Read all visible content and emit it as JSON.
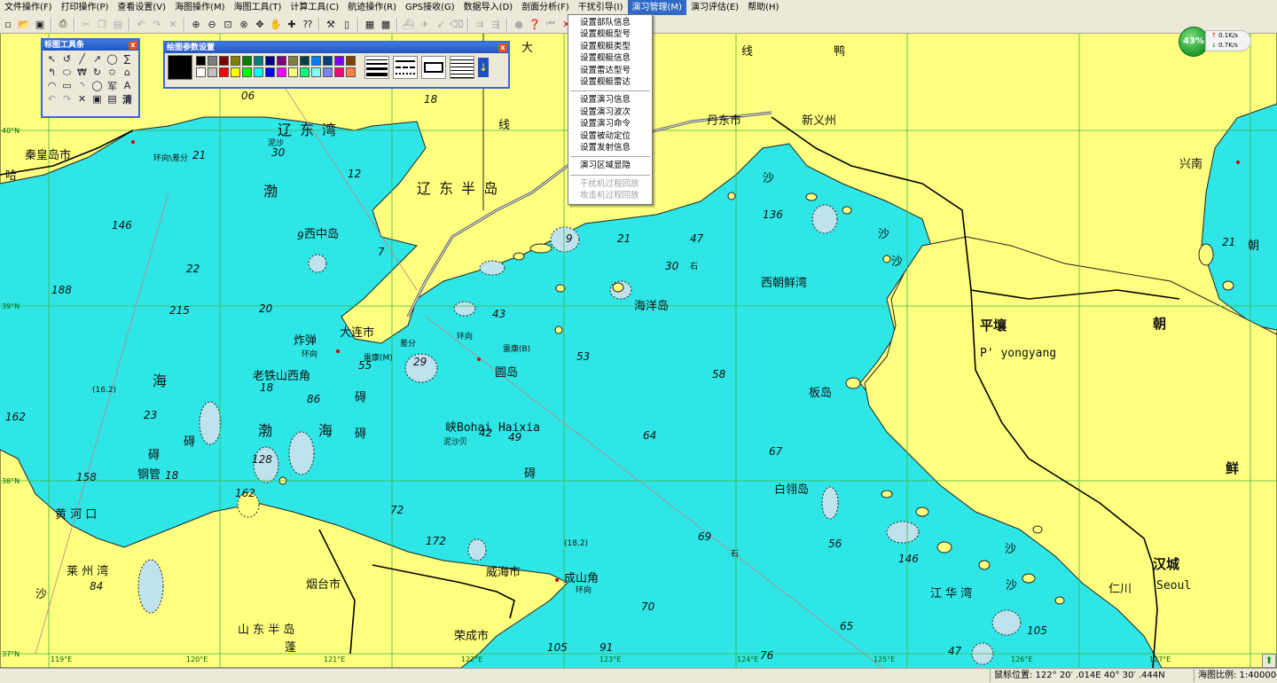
{
  "menubar": [
    "文件操作(F)",
    "打印操作(P)",
    "查看设置(V)",
    "海图操作(M)",
    "海图工具(T)",
    "计算工具(C)",
    "航迹操作(R)",
    "GPS接收(G)",
    "数据导入(D)",
    "剖面分析(F)",
    "干扰引导(I)",
    "演习管理(M)",
    "演习评估(E)",
    "帮助(H)"
  ],
  "dropdown": {
    "group1": [
      "设置部队信息",
      "设置舰艇型号",
      "设置舰艇类型",
      "设置舰艇信息",
      "设置雷达型号",
      "设置舰艇雷达"
    ],
    "group2": [
      "设置演习信息",
      "设置演习波次",
      "设置演习命令",
      "设置被动定位",
      "设置发射信息"
    ],
    "group3": [
      "演习区域显隐"
    ],
    "group4_disabled": [
      "干扰机过程回放",
      "攻击机过程回放"
    ]
  },
  "toolwin_draw": {
    "title": "标图工具条",
    "close": "x",
    "tools": [
      "↖",
      "↺",
      "╱",
      "↗",
      "◯",
      "∑",
      "↰",
      "⬭",
      "₩",
      "↻",
      "✩",
      "⌂",
      "◠",
      "▭",
      "◝",
      "◯",
      "军",
      "A",
      "↶",
      "↷",
      "✕",
      "▣",
      "▤",
      "清"
    ]
  },
  "toolwin_params": {
    "title": "绘图参数设置",
    "close": "x"
  },
  "colors": {
    "palette_top": [
      "#000000",
      "#808080",
      "#800000",
      "#808000",
      "#008000",
      "#008080",
      "#000080",
      "#800080",
      "#808040",
      "#004040",
      "#0080ff",
      "#004080",
      "#8000ff",
      "#804000"
    ],
    "palette_bottom": [
      "#ffffff",
      "#c0c0c0",
      "#ff0000",
      "#ffff00",
      "#00ff00",
      "#00ffff",
      "#0000ff",
      "#ff00ff",
      "#ffff80",
      "#00ff80",
      "#80ffff",
      "#8080ff",
      "#ff0080",
      "#ff8040"
    ],
    "sea": "#2ee6e6",
    "land": "#ffff7f",
    "shoal": "#bfe3ee",
    "grid": "#3fb53f"
  },
  "network": {
    "percent": "43%",
    "up": "0.1K/s",
    "down": "0.7K/s"
  },
  "statusbar": {
    "mouse_label": "鼠标位置: 122° 20′ .014E    40° 30′ .444N",
    "scale_label": "海图比例: 1:4000000"
  },
  "grid_labels": {
    "lat": [
      "40°N",
      "39°N",
      "38°N",
      "37°N"
    ],
    "lon": [
      "119°E",
      "120°E",
      "121°E",
      "122°E",
      "123°E",
      "124°E",
      "125°E",
      "126°E",
      "127°E"
    ]
  },
  "places": {
    "qinhuangdao": "秦皇岛市",
    "ha": "哈",
    "liaodongwan": "辽 东 湾",
    "bo1": "渤",
    "xizhongdao": "西中岛",
    "liaodong_bandao": "辽 东 半 岛",
    "dandong": "丹东市",
    "xinyizhou": "新义州",
    "da": "大",
    "xian1": "线",
    "xian2": "线",
    "ya": "鸭",
    "xingnan": "兴南",
    "xichaoxianwan": "西朝鲜湾",
    "haiyangdao": "海洋岛",
    "pingrang": "平壤",
    "pyongyang": "P' yongyang",
    "chao": "朝",
    "xian3": "鲜",
    "dalian": "大连市",
    "zhadan": "炸弹",
    "laotieshan": "老铁山西角",
    "hai": "海",
    "bo2": "渤",
    "hai2": "海",
    "ai1": "碍",
    "ai2": "碍",
    "ai3": "碍",
    "ai4": "碍",
    "ai5": "碍",
    "bohaixia": "峡Bohai  Haixia",
    "yuandao": "圆岛",
    "bandao": "板岛",
    "bailingdao": "白翎岛",
    "gangguan": "钢管",
    "huanghekou": "黄 河 口",
    "laizhouwan": "莱    州    湾",
    "sha1": "沙",
    "yantai": "烟台市",
    "weihai": "威海市",
    "chengshanjiao": "成山角",
    "rongcheng": "荣成市",
    "shandong_bandao": "山    东    半    岛",
    "penglai": "蓬",
    "jianghuawan": "江  华  湾",
    "renchuan": "仁川",
    "hancheng": "汉城",
    "seoul": "Seoul",
    "sha2": "沙",
    "sha3": "沙",
    "sha4": "沙",
    "sha5": "沙",
    "sha6": "沙",
    "shi1": "石",
    "shi2": "石",
    "zhao": "朝",
    "ni": "泥沙",
    "ni2": "泥沙贝",
    "huanxiang1": "环向\\差分",
    "huanxiang2": "环向",
    "huanxiang3": "环向",
    "huanxiang4": "环向",
    "chafen": "差分",
    "leikang_m": "雷康(M)",
    "leikang_b": "雷康(B)",
    "shiersix": "(16.2)",
    "shiba": "(18.2)",
    "xing21": "21"
  },
  "depths": [
    "06",
    "18",
    "30",
    "21",
    "12",
    "146",
    "22",
    "188",
    "215",
    "20",
    "9",
    "7",
    "21",
    "9",
    "30",
    "47",
    "136",
    "43",
    "55",
    "29",
    "53",
    "58",
    "18",
    "86",
    "162",
    "23",
    "128",
    "18",
    "158",
    "162",
    "72",
    "172",
    "42",
    "49",
    "64",
    "67",
    "69",
    "56",
    "146",
    "84",
    "70",
    "65",
    "105",
    "47",
    "76",
    "105",
    "91"
  ]
}
